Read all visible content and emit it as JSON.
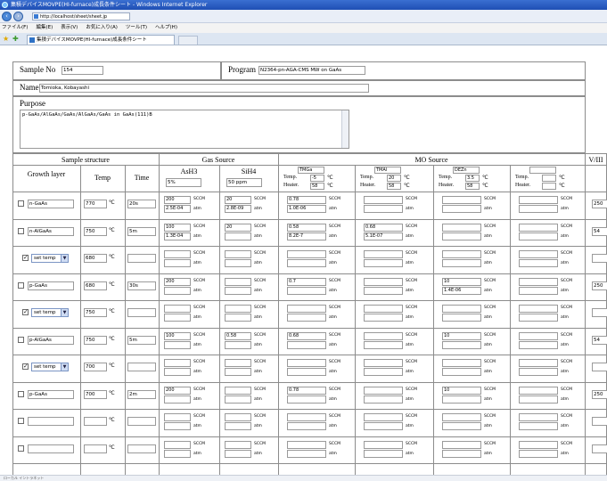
{
  "window": {
    "title": "集積デバイスMOVPE(HI-furnace)成長条件シート - Windows Internet Explorer",
    "address": "http://localhost/sheet/sheet.jp"
  },
  "menu": [
    "ファイル(F)",
    "編集(E)",
    "表示(V)",
    "お気に入り(A)",
    "ツール(T)",
    "ヘルプ(H)"
  ],
  "tab": {
    "label": "集積デバイスMOVPE(HI-furnace)成長条件シート"
  },
  "form": {
    "sample_no_label": "Sample No",
    "sample_no_value": "154",
    "program_label": "Program",
    "program_value": "N2364-pn-AGA-CMS MW on GaAs",
    "name_label": "Name",
    "name_value": "Tomioka, Kobayashi",
    "purpose_label": "Purpose",
    "purpose_value": "p-GaAs/AlGaAs/GaAs/AlGaAs/GaAs in GaAs(111)B"
  },
  "headers": {
    "sample_structure": "Sample structure",
    "gas_source": "Gas Source",
    "mo_source": "MO Source",
    "v_iii": "V/III",
    "growth_layer": "Growth layer",
    "temp": "Temp",
    "time": "Time",
    "ash3": "AsH3",
    "sih4": "SiH4",
    "ash3_conc": "5%",
    "sih4_conc": "50 ppm",
    "temp_label": "Temp.",
    "heater_label": "Heater.",
    "deg": "℃"
  },
  "mo_columns": [
    {
      "name": "TMGa",
      "temp": "-5",
      "heater": "58"
    },
    {
      "name": "TMAl",
      "temp": "20",
      "heater": "58"
    },
    {
      "name": "DEZn",
      "temp": "3.5",
      "heater": "58"
    },
    {
      "name": "",
      "temp": "",
      "heater": ""
    }
  ],
  "units": {
    "flow": "SCCM",
    "pressure": "atm"
  },
  "rows": [
    {
      "checked": false,
      "layer": "n-GaAs",
      "is_select": false,
      "temp": "770",
      "time": "20s",
      "ash3": [
        "200",
        "2.5E-04"
      ],
      "sih4": [
        "20",
        "2.8E-09"
      ],
      "mo": [
        [
          "0.78",
          "1.0E-06"
        ],
        [
          "",
          ""
        ],
        [
          "",
          ""
        ],
        [
          "",
          ""
        ]
      ],
      "viii": "250"
    },
    {
      "checked": false,
      "layer": "n-AlGaAs",
      "is_select": false,
      "temp": "750",
      "time": "5m",
      "ash3": [
        "100",
        "1.3E-04"
      ],
      "sih4": [
        "20",
        ""
      ],
      "mo": [
        [
          "0.58",
          "8.2E-7"
        ],
        [
          "0.68",
          "5.1E-07"
        ],
        [
          "",
          ""
        ],
        [
          "",
          ""
        ]
      ],
      "viii": "54"
    },
    {
      "checked": true,
      "layer": "set temp",
      "is_select": true,
      "temp": "680",
      "time": "",
      "ash3": [
        "",
        ""
      ],
      "sih4": [
        "",
        ""
      ],
      "mo": [
        [
          "",
          ""
        ],
        [
          "",
          ""
        ],
        [
          "",
          ""
        ],
        [
          "",
          ""
        ]
      ],
      "viii": ""
    },
    {
      "checked": false,
      "layer": "p-GaAs",
      "is_select": false,
      "temp": "680",
      "time": "30s",
      "ash3": [
        "200",
        ""
      ],
      "sih4": [
        "",
        ""
      ],
      "mo": [
        [
          "0.7",
          ""
        ],
        [
          "",
          ""
        ],
        [
          "10",
          "1.4E-06"
        ],
        [
          "",
          ""
        ]
      ],
      "viii": "250"
    },
    {
      "checked": true,
      "layer": "set temp",
      "is_select": true,
      "temp": "750",
      "time": "",
      "ash3": [
        "",
        ""
      ],
      "sih4": [
        "",
        ""
      ],
      "mo": [
        [
          "",
          ""
        ],
        [
          "",
          ""
        ],
        [
          "",
          ""
        ],
        [
          "",
          ""
        ]
      ],
      "viii": ""
    },
    {
      "checked": false,
      "layer": "p-AlGaAs",
      "is_select": false,
      "temp": "750",
      "time": "5m",
      "ash3": [
        "100",
        ""
      ],
      "sih4": [
        "0.58",
        ""
      ],
      "mo": [
        [
          "0.68",
          ""
        ],
        [
          "",
          ""
        ],
        [
          "10",
          ""
        ],
        [
          "",
          ""
        ]
      ],
      "viii": "54"
    },
    {
      "checked": true,
      "layer": "set temp",
      "is_select": true,
      "temp": "700",
      "time": "",
      "ash3": [
        "",
        ""
      ],
      "sih4": [
        "",
        ""
      ],
      "mo": [
        [
          "",
          ""
        ],
        [
          "",
          ""
        ],
        [
          "",
          ""
        ],
        [
          "",
          ""
        ]
      ],
      "viii": ""
    },
    {
      "checked": false,
      "layer": "p-GaAs",
      "is_select": false,
      "temp": "700",
      "time": "2m",
      "ash3": [
        "200",
        ""
      ],
      "sih4": [
        "",
        ""
      ],
      "mo": [
        [
          "0.78",
          ""
        ],
        [
          "",
          ""
        ],
        [
          "10",
          ""
        ],
        [
          "",
          ""
        ]
      ],
      "viii": "250"
    },
    {
      "checked": false,
      "layer": "",
      "is_select": false,
      "temp": "",
      "time": "",
      "ash3": [
        "",
        ""
      ],
      "sih4": [
        "",
        ""
      ],
      "mo": [
        [
          "",
          ""
        ],
        [
          "",
          ""
        ],
        [
          "",
          ""
        ],
        [
          "",
          ""
        ]
      ],
      "viii": ""
    },
    {
      "checked": false,
      "layer": "",
      "is_select": false,
      "temp": "",
      "time": "",
      "ash3": [
        "",
        ""
      ],
      "sih4": [
        "",
        ""
      ],
      "mo": [
        [
          "",
          ""
        ],
        [
          "",
          ""
        ],
        [
          "",
          ""
        ],
        [
          "",
          ""
        ]
      ],
      "viii": ""
    }
  ],
  "status": "ローカル イントラネット"
}
